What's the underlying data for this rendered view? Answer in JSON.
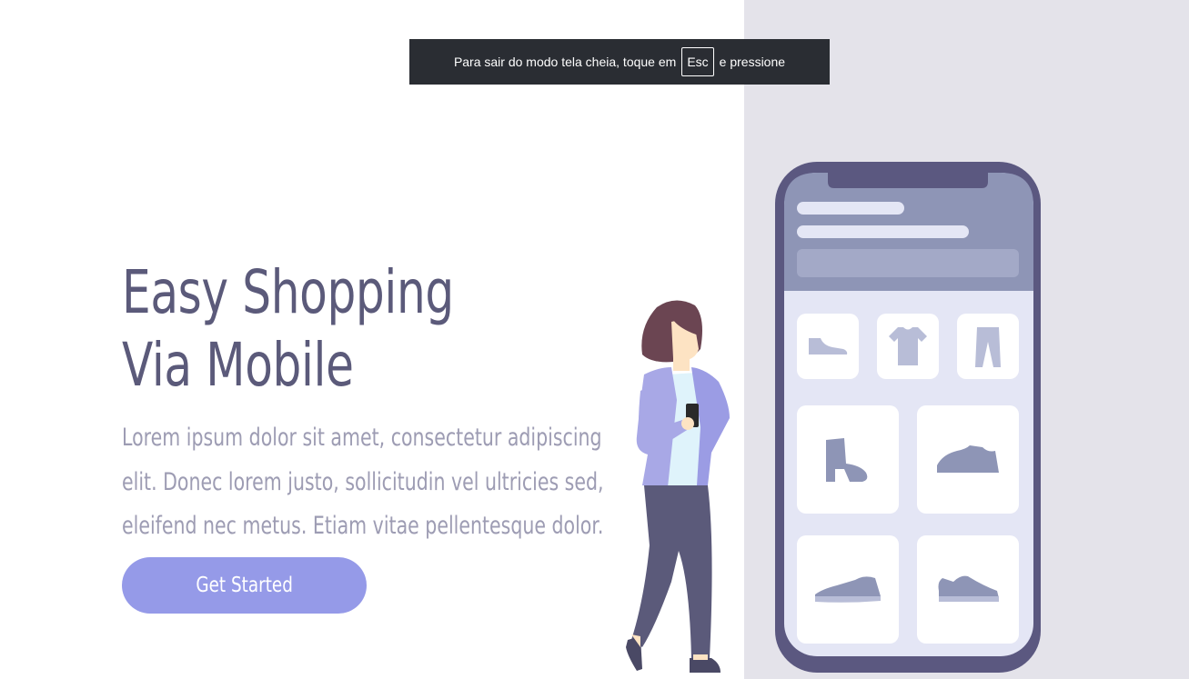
{
  "fullscreen_notice": {
    "before": "Para sair do modo tela cheia, toque em",
    "key": "Esc",
    "after": "e pressione"
  },
  "hero": {
    "title_line1": "Easy Shopping",
    "title_line2": "Via Mobile",
    "description": "Lorem ipsum dolor sit amet, consectetur adipiscing elit. Donec lorem justo, sollicitudin vel ultricies sed, eleifend nec metus. Etiam vitae pellentesque dolor.",
    "button_label": "Get Started"
  },
  "colors": {
    "background": "#ffffff",
    "right_panel": "#e4e3ea",
    "title": "#5b5a7a",
    "body_text": "#9d9cb3",
    "button": "#959ae8",
    "phone_frame": "#5b5880",
    "phone_header": "#8e95b6",
    "phone_screen": "#e4e6f5",
    "product_icon": "#8e95b6"
  },
  "illustration": {
    "icons": [
      "shoe-icon",
      "tshirt-icon",
      "pants-icon",
      "boot-icon",
      "sneaker-icon",
      "flat-shoe-icon",
      "low-sneaker-icon"
    ]
  }
}
